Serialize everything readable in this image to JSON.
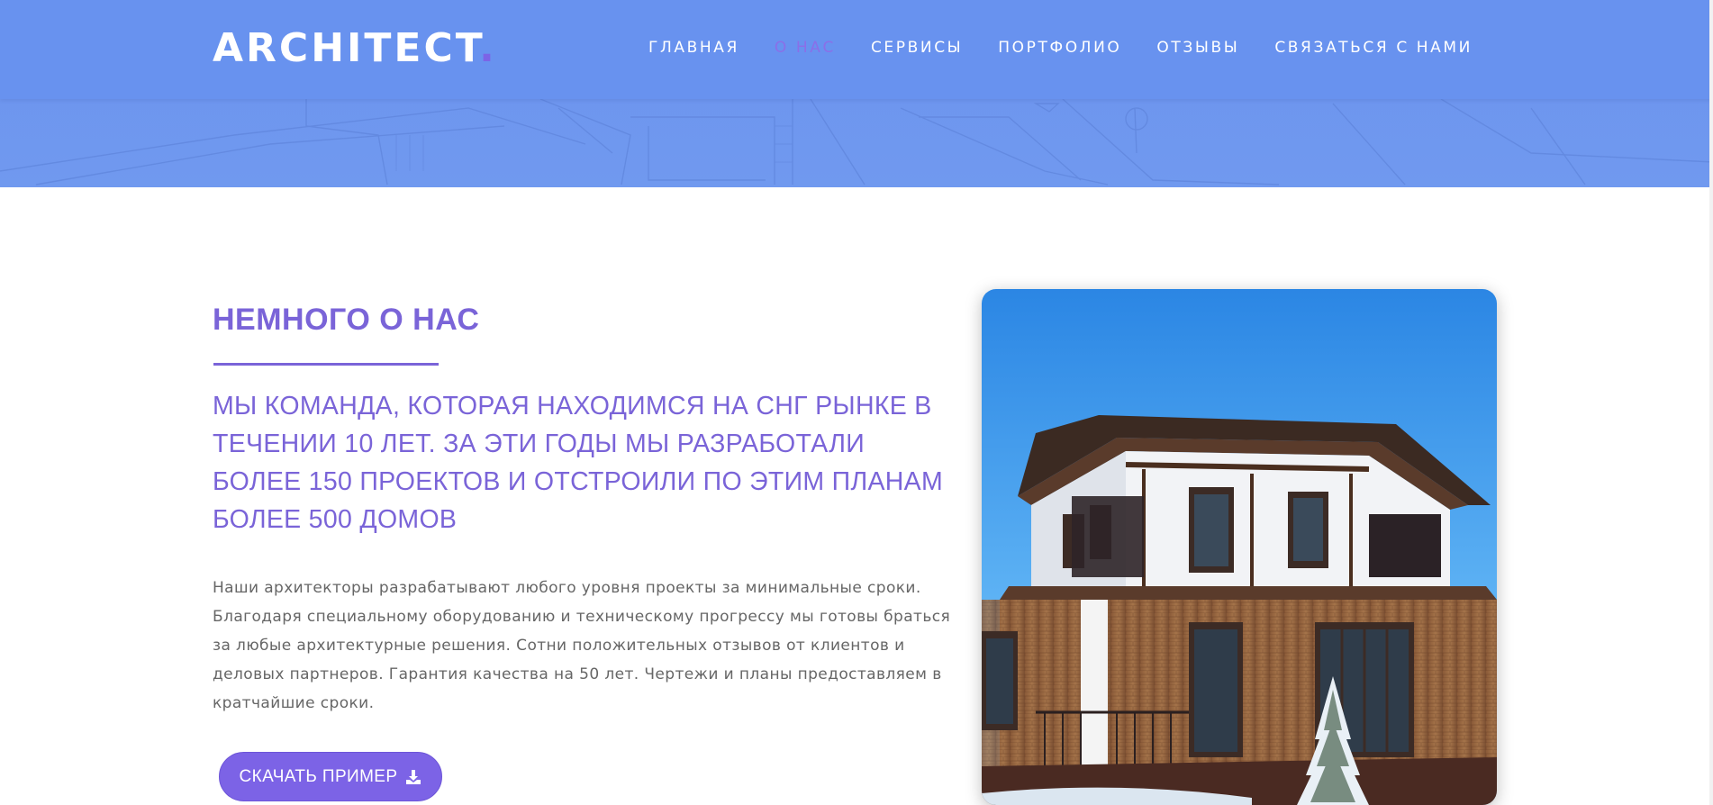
{
  "brand": {
    "name": "ARCHITECT",
    "dot": "."
  },
  "nav": {
    "items": [
      {
        "label": "ГЛАВНАЯ",
        "active": false
      },
      {
        "label": "О НАС",
        "active": true
      },
      {
        "label": "СЕРВИСЫ",
        "active": false
      },
      {
        "label": "ПОРТФОЛИО",
        "active": false
      },
      {
        "label": "ОТЗЫВЫ",
        "active": false
      },
      {
        "label": "СВЯЗАТЬСЯ С НАМИ",
        "active": false
      }
    ]
  },
  "about": {
    "heading": "НЕМНОГО О НАС",
    "lead": "МЫ КОМАНДА, КОТОРАЯ НАХОДИМСЯ НА СНГ РЫНКЕ В ТЕЧЕНИИ 10 ЛЕТ. ЗА ЭТИ ГОДЫ МЫ РАЗРАБОТАЛИ БОЛЕЕ 150 ПРОЕКТОВ И ОТСТРОИЛИ ПО ЭТИМ ПЛАНАМ БОЛЕЕ 500 ДОМОВ",
    "text": "Наши архитекторы разрабатывают любого уровня проекты за минимальные сроки. Благодаря специальному оборудованию и техническому прогрессу мы готовы браться за любые архитектурные решения. Сотни положительных отзывов от клиентов и деловых партнеров. Гарантия качества на 50 лет. Чертежи и планы предоставляем в кратчайшие сроки.",
    "button_label": "СКАЧАТЬ ПРИМЕР",
    "button_icon": "download-icon",
    "photo_icon": "house-photo"
  },
  "colors": {
    "header_bg": "#6892ef",
    "accent": "#7c63e6",
    "heading": "#7a64d8",
    "body_text": "#666666"
  }
}
